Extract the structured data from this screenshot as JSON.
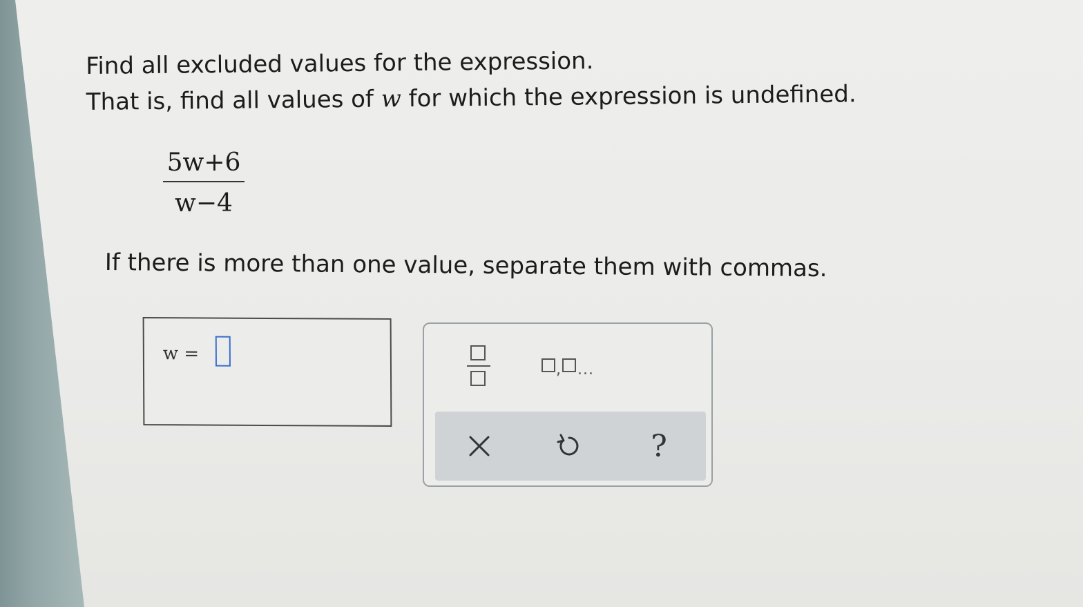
{
  "question": {
    "line1": "Find all excluded values for the expression.",
    "line2_before": "That is, find all values of ",
    "variable": "w",
    "line2_after": " for which the expression is undefined."
  },
  "expression": {
    "numerator": "5w+6",
    "denominator": "w−4"
  },
  "note": "If there is more than one value, separate them with commas.",
  "answer": {
    "label": "w =",
    "value": ""
  },
  "palette": {
    "fraction_icon": "fraction-template-icon",
    "list_icon": "list-template-icon",
    "list_dots": "...",
    "clear_icon": "close-icon",
    "undo_icon": "undo-icon",
    "help_label": "?"
  }
}
